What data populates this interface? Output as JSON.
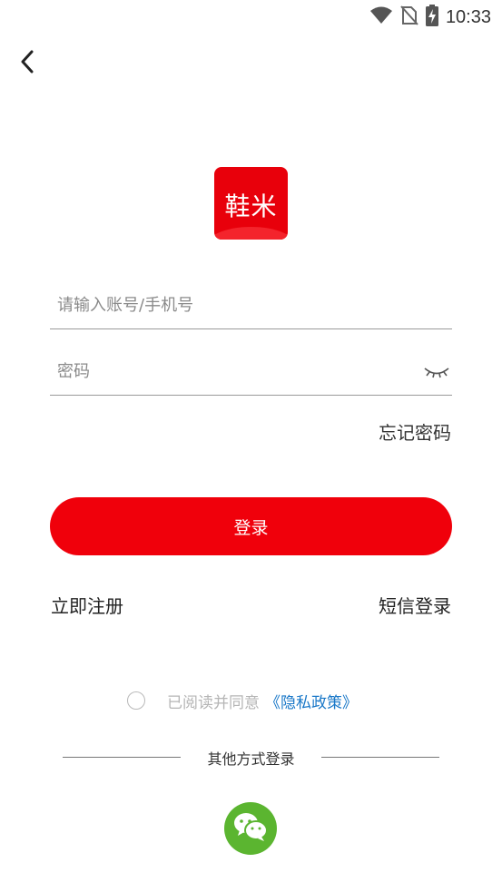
{
  "status_bar": {
    "time": "10:33",
    "icons": [
      "wifi-icon",
      "no-sim-icon",
      "battery-charging-icon"
    ]
  },
  "header": {
    "back_icon": "chevron-left-icon"
  },
  "logo": {
    "text": "鞋米",
    "color": "#e8000b"
  },
  "form": {
    "account_placeholder": "请输入账号/手机号",
    "account_value": "",
    "password_placeholder": "密码",
    "password_value": "",
    "password_toggle_icon": "eye-closed-icon",
    "forgot_password": "忘记密码",
    "login_label": "登录",
    "login_color": "#f0000b"
  },
  "links": {
    "register": "立即注册",
    "sms_login": "短信登录"
  },
  "agreement": {
    "text": "已阅读并同意",
    "policy_link": "《隐私政策》",
    "link_color": "#1a78c8"
  },
  "other_login": {
    "label": "其他方式登录",
    "wechat_icon": "wechat-icon",
    "wechat_color": "#5bb530"
  }
}
